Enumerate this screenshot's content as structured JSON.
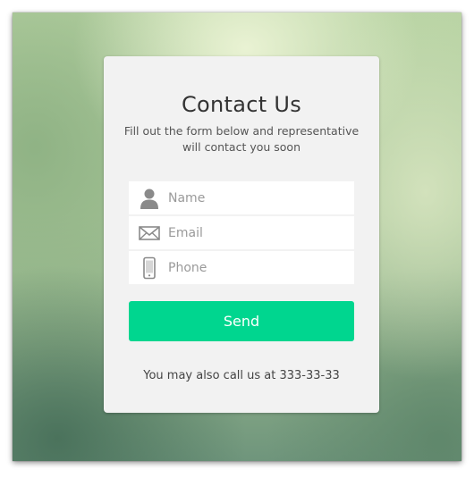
{
  "form": {
    "title": "Contact Us",
    "subtitle": "Fill out the form below and representative will contact you soon",
    "fields": [
      {
        "name": "name",
        "placeholder": "Name",
        "value": "",
        "icon": "user-icon"
      },
      {
        "name": "email",
        "placeholder": "Email",
        "value": "",
        "icon": "envelope-icon"
      },
      {
        "name": "phone",
        "placeholder": "Phone",
        "value": "",
        "icon": "phone-icon"
      }
    ],
    "send_label": "Send",
    "footer_text": "You may also call us at 333-33-33"
  },
  "colors": {
    "accent": "#00d68f",
    "card_background": "#f2f2f2",
    "icon": "#8a8a8a"
  }
}
